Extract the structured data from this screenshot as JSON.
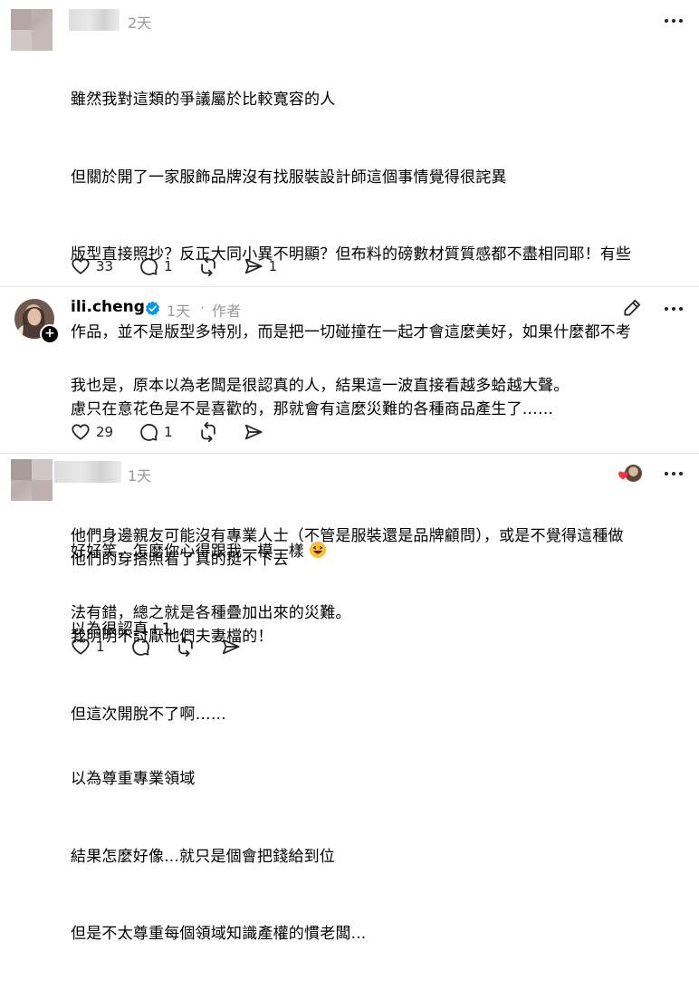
{
  "comments": [
    {
      "time": "2天",
      "lines": [
        "雖然我對這類的爭議屬於比較寬容的人",
        "但關於開了一家服飾品牌沒有找服裝設計師這個事情覺得很詫異",
        "版型直接照抄？反正大同小異不明顯？但布料的磅數材質質感都不盡相同耶！有些",
        "作品，並不是版型多特別，而是把一切碰撞在一起才會這麼美好，如果什麼都不考",
        "慮只在意花色是不是喜歡的，那就會有這麼災難的各種商品產生了……",
        "他們的穿搭照看了真的挺不下去",
        "我明明不討厭他們夫妻檔的！",
        "但這次開脫不了啊……"
      ],
      "likes": "33",
      "replies": "1",
      "shares": "1"
    },
    {
      "username": "ili.cheng",
      "time": "1天",
      "separator": "·",
      "role": "作者",
      "lines": [
        "我也是，原本以為老闆是很認真的人，結果這一波直接看越多蛤越大聲。",
        "他們身邊親友可能沒有專業人士（不管是服裝還是品牌顧問），或是不覺得這種做",
        "法有錯，總之就是各種疊加出來的災難。"
      ],
      "likes": "29",
      "replies": "1"
    },
    {
      "time": "1天",
      "lines": [
        "好好笑，怎麼你心得跟我一模一樣",
        "以為很認真+1",
        "以為尊重專業領域",
        "結果怎麼好像...就只是個會把錢給到位",
        "但是不太尊重每個領域知識產權的慣老闆..."
      ],
      "likes": "1"
    }
  ],
  "colors": {
    "text": "#000000",
    "muted": "#999999",
    "verified": "#0095f6",
    "heart": "#ff3040"
  },
  "icons": [
    "heart-icon",
    "reply-icon",
    "repost-icon",
    "share-icon",
    "more-icon",
    "edit-icon",
    "verified-icon",
    "plus-icon",
    "grinning-emoji-icon"
  ]
}
